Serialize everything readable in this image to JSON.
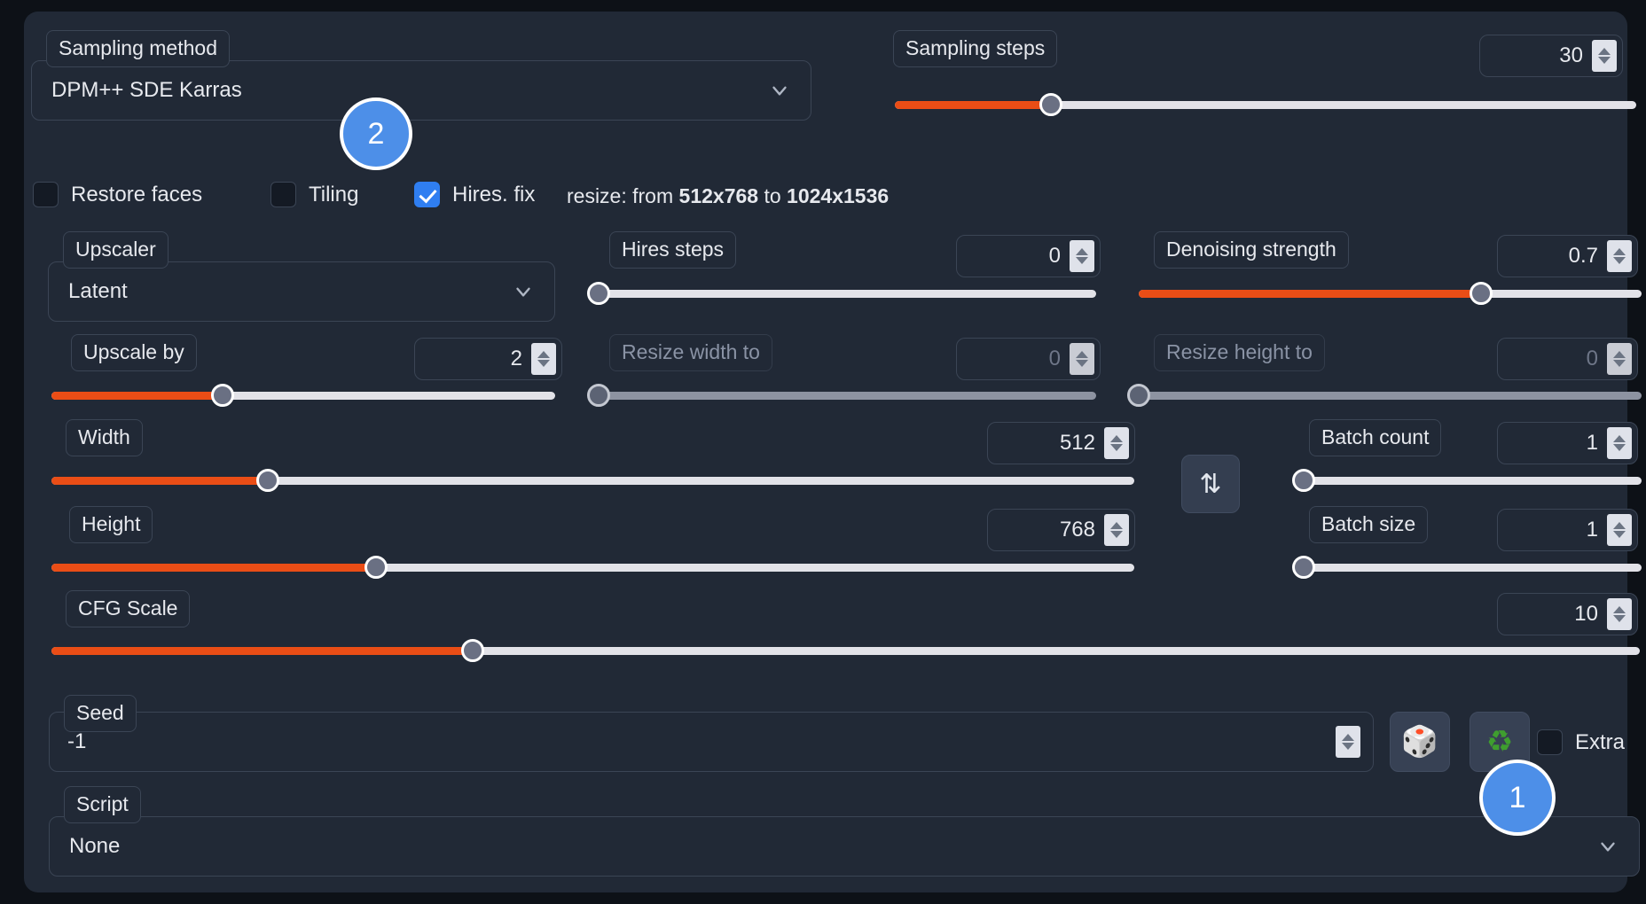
{
  "panel": {
    "sampling_method": {
      "label": "Sampling method",
      "value": "DPM++ SDE Karras",
      "icon": "chevron-down-icon"
    },
    "sampling_steps": {
      "label": "Sampling steps",
      "value": "30",
      "slider_percent": 21
    },
    "toggles": {
      "restore_faces": {
        "label": "Restore faces",
        "checked": false
      },
      "tiling": {
        "label": "Tiling",
        "checked": false
      },
      "hires_fix": {
        "label": "Hires. fix",
        "checked": true
      },
      "resize_prefix": "resize: from",
      "resize_from": "512x768",
      "resize_mid": "to",
      "resize_to": "1024x1536"
    },
    "upscaler": {
      "label": "Upscaler",
      "value": "Latent"
    },
    "hires_steps": {
      "label": "Hires steps",
      "value": "0",
      "slider_percent": 0
    },
    "denoising_strength": {
      "label": "Denoising strength",
      "value": "0.7",
      "slider_percent": 68
    },
    "upscale_by": {
      "label": "Upscale by",
      "value": "2",
      "slider_percent": 34
    },
    "resize_width_to": {
      "label": "Resize width to",
      "value": "0",
      "slider_percent": 0,
      "disabled": true
    },
    "resize_height_to": {
      "label": "Resize height to",
      "value": "0",
      "slider_percent": 0,
      "disabled": true
    },
    "width": {
      "label": "Width",
      "value": "512",
      "slider_percent": 23
    },
    "height": {
      "label": "Height",
      "value": "768",
      "slider_percent": 35
    },
    "swap_button": {
      "icon": "swap-dimensions-icon",
      "glyph": "⇅"
    },
    "batch_count": {
      "label": "Batch count",
      "value": "1",
      "slider_percent": 0
    },
    "batch_size": {
      "label": "Batch size",
      "value": "1",
      "slider_percent": 0
    },
    "cfg_scale": {
      "label": "CFG Scale",
      "value": "10",
      "slider_percent": 31
    },
    "seed": {
      "label": "Seed",
      "value": "-1"
    },
    "seed_buttons": {
      "random": {
        "icon": "dice-icon",
        "glyph": "🎲"
      },
      "reuse": {
        "icon": "recycle-icon",
        "glyph": "♻"
      }
    },
    "extra": {
      "label": "Extra",
      "checked": false
    },
    "script": {
      "label": "Script",
      "value": "None"
    }
  },
  "annotations": {
    "badge_one": "1",
    "badge_two": "2"
  },
  "colors": {
    "accent_orange": "#ea4d16",
    "accent_blue": "#2f7ef1",
    "badge_blue": "#4d8fe8",
    "panel_bg": "#212936",
    "page_bg": "#0d1117"
  }
}
